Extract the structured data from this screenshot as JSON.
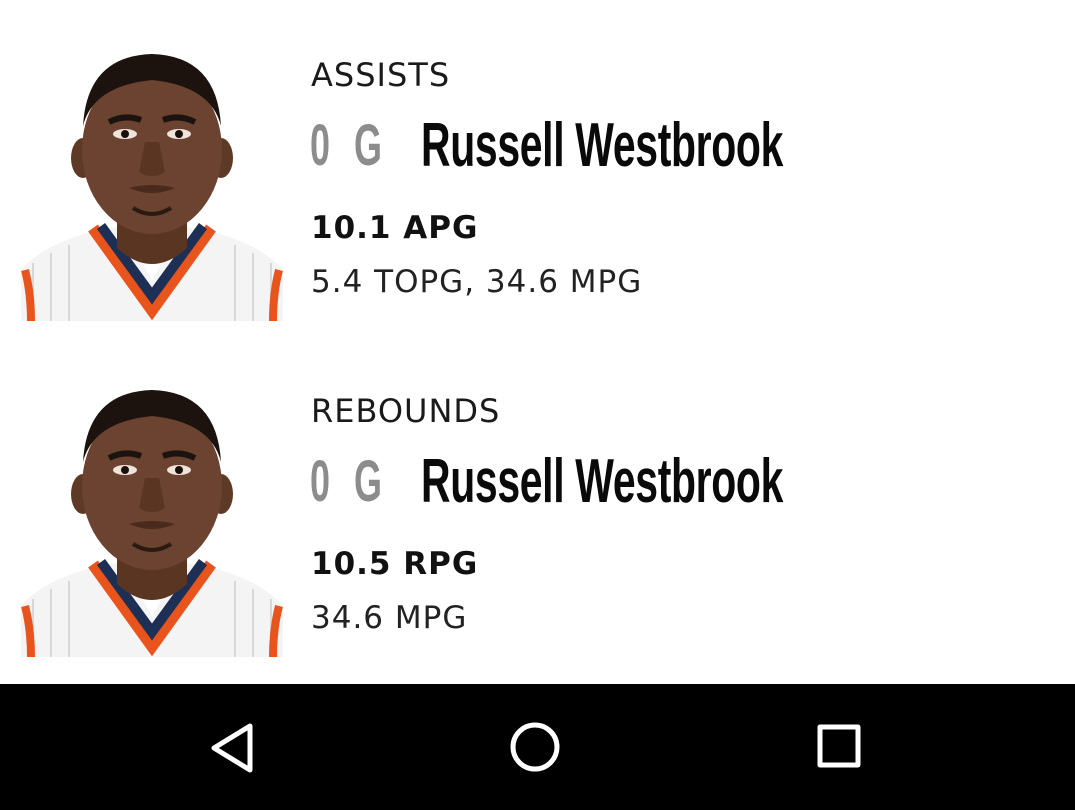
{
  "leaders": [
    {
      "category": "ASSISTS",
      "jersey": "0",
      "position": "G",
      "name": "Russell Westbrook",
      "primary_stat": "10.1 APG",
      "secondary_stat": "5.4 TOPG, 34.6 MPG"
    },
    {
      "category": "REBOUNDS",
      "jersey": "0",
      "position": "G",
      "name": "Russell Westbrook",
      "primary_stat": "10.5 RPG",
      "secondary_stat": "34.6 MPG"
    }
  ],
  "navigation": {
    "back_icon": "back-triangle-icon",
    "home_icon": "home-circle-icon",
    "recents_icon": "recents-square-icon"
  },
  "colors": {
    "background": "#ffffff",
    "nav_bar": "#000000",
    "nav_icons": "#ffffff",
    "muted_text": "#8c8c8c",
    "jersey_orange": "#e8541c",
    "jersey_navy": "#1e2f55"
  }
}
